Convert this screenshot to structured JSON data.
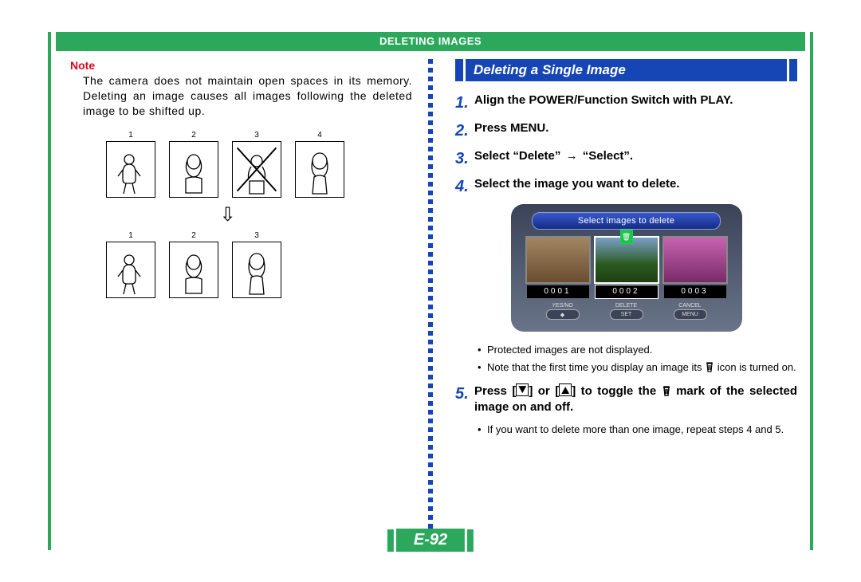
{
  "header": {
    "title": "DELETING IMAGES"
  },
  "left": {
    "note_label": "Note",
    "note_text": "The camera does not maintain open spaces in its memory. Deleting an image causes all images following the deleted image to be shifted up.",
    "top_row_numbers": [
      "1",
      "2",
      "3",
      "4"
    ],
    "bottom_row_numbers": [
      "1",
      "2",
      "3"
    ]
  },
  "right": {
    "section_title": "Deleting a Single Image",
    "steps": {
      "s1": "Align the POWER/Function Switch with PLAY.",
      "s2": "Press MENU.",
      "s3_a": "Select “Delete” ",
      "s3_b": " “Select”.",
      "s4": "Select the image you want to delete.",
      "s5_a": "Press [",
      "s5_b": "] or [",
      "s5_c": "] to toggle the ",
      "s5_d": " mark of the selected image on and off."
    },
    "screen": {
      "banner": "Select images to delete",
      "counters": [
        "0001",
        "0002",
        "0003"
      ],
      "btn1_top": "YES/NO",
      "btn2_top": "DELETE",
      "btn2_bot": "SET",
      "btn3_top": "CANCEL",
      "btn3_bot": "MENU"
    },
    "sub4_a": "Protected images are not displayed.",
    "sub4_b_a": "Note that the first time you display an image its ",
    "sub4_b_b": " icon is turned on.",
    "sub5": "If you want to delete more than one image, repeat steps 4 and 5."
  },
  "page_number": "E-92"
}
